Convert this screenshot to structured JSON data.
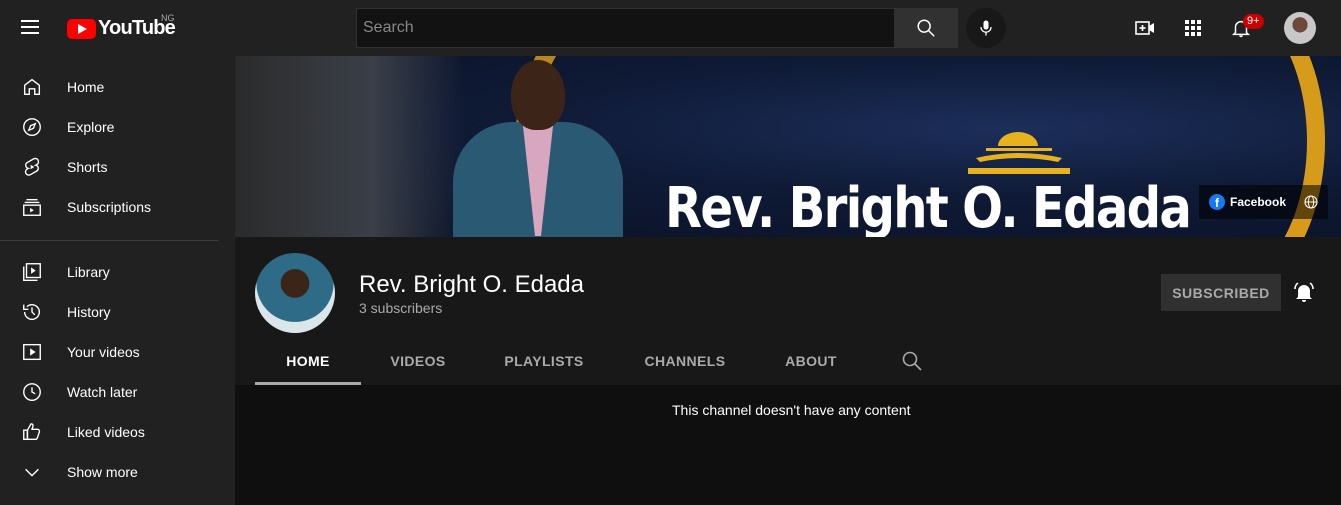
{
  "header": {
    "logo_text": "YouTube",
    "country": "NG",
    "search_placeholder": "Search",
    "notification_count": "9+"
  },
  "sidebar": {
    "items": [
      {
        "label": "Home",
        "icon": "home-icon"
      },
      {
        "label": "Explore",
        "icon": "compass-icon"
      },
      {
        "label": "Shorts",
        "icon": "shorts-icon"
      },
      {
        "label": "Subscriptions",
        "icon": "subscriptions-icon"
      },
      {
        "label": "Library",
        "icon": "library-icon"
      },
      {
        "label": "History",
        "icon": "history-icon"
      },
      {
        "label": "Your videos",
        "icon": "your-videos-icon"
      },
      {
        "label": "Watch later",
        "icon": "clock-icon"
      },
      {
        "label": "Liked videos",
        "icon": "thumbs-up-icon"
      },
      {
        "label": "Show more",
        "icon": "chevron-down-icon"
      }
    ]
  },
  "banner": {
    "title": "Rev. Bright O. Edada",
    "social_link": "Facebook",
    "accent_color": "#e2a21a"
  },
  "channel": {
    "name": "Rev. Bright O. Edada",
    "subscribers": "3 subscribers",
    "subscribe_label": "SUBSCRIBED"
  },
  "tabs": [
    {
      "label": "HOME",
      "active": true
    },
    {
      "label": "VIDEOS",
      "active": false
    },
    {
      "label": "PLAYLISTS",
      "active": false
    },
    {
      "label": "CHANNELS",
      "active": false
    },
    {
      "label": "ABOUT",
      "active": false
    }
  ],
  "content": {
    "empty_message": "This channel doesn't have any content"
  }
}
